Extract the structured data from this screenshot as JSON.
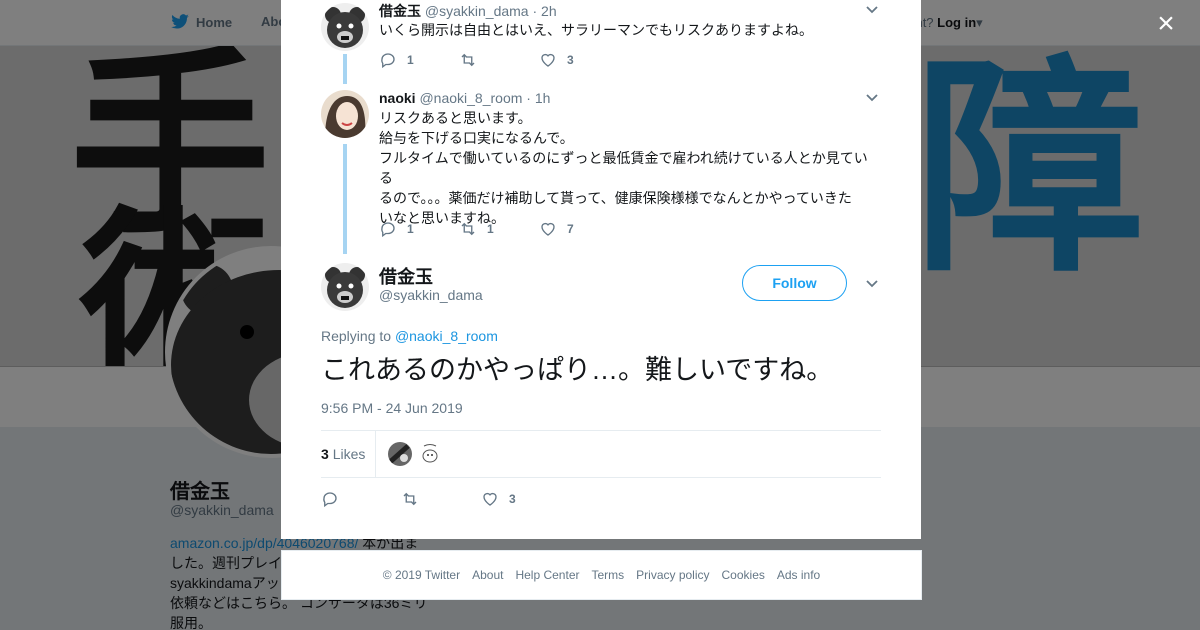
{
  "background": {
    "nav": {
      "home_label": "Home",
      "about_label": "Abo"
    },
    "login": {
      "prompt": "ccount?",
      "link": "Log in"
    },
    "banner_text": {
      "k1": "手",
      "k2": "術",
      "k3": "障"
    },
    "profile": {
      "name": "借金玉",
      "handle": "@syakkin_dama",
      "bio_link": "amazon.co.jp/dp/4046020768/",
      "bio_line1": "本が出ま",
      "bio_line2": "した。週刊プレイ",
      "bio_line3": "syakkindamaアッ",
      "bio_line4": "依頼などはこちら。 コンサータは36ミリ",
      "bio_line5": "服用。"
    }
  },
  "close_label": "×",
  "thread": [
    {
      "name": "借金玉",
      "handle": "@syakkin_dama",
      "time": "2h",
      "text": "いくら開示は自由とはいえ、サラリーマンでもリスクありますよね。",
      "replies": "1",
      "retweets": "",
      "likes": "3"
    },
    {
      "name": "naoki",
      "handle": "@naoki_8_room",
      "time": "1h",
      "text_lines": [
        "リスクあると思います。",
        "給与を下げる口実になるんで。",
        "フルタイムで働いているのにずっと最低賃金で雇われ続けている人とか見ている",
        "るので。。。薬価だけ補助して貰って、健康保険様様でなんとかやっていきた",
        "いなと思いますね。"
      ],
      "replies": "1",
      "retweets": "1",
      "likes": "7"
    }
  ],
  "main_tweet": {
    "name": "借金玉",
    "handle": "@syakkin_dama",
    "follow_label": "Follow",
    "replying_prefix": "Replying to",
    "replying_to": "@naoki_8_room",
    "text": "これあるのかやっぱり…。難しいですね。",
    "timestamp": "9:56 PM - 24 Jun 2019",
    "likes_count": "3",
    "likes_label": "Likes",
    "action_likes": "3"
  },
  "footer": {
    "links": [
      "© 2019 Twitter",
      "About",
      "Help Center",
      "Terms",
      "Privacy policy",
      "Cookies",
      "Ads info"
    ]
  },
  "colors": {
    "accent": "#1da1f2",
    "link": "#1b95e0",
    "thread_line": "#a6d4f2",
    "muted": "#657786",
    "banner_blue": "#1d8ac9"
  },
  "icons": {
    "reply": "reply-icon",
    "retweet": "retweet-icon",
    "like": "heart-icon",
    "caret": "chevron-down-icon",
    "brand": "twitter-bird-icon",
    "close": "close-icon"
  }
}
